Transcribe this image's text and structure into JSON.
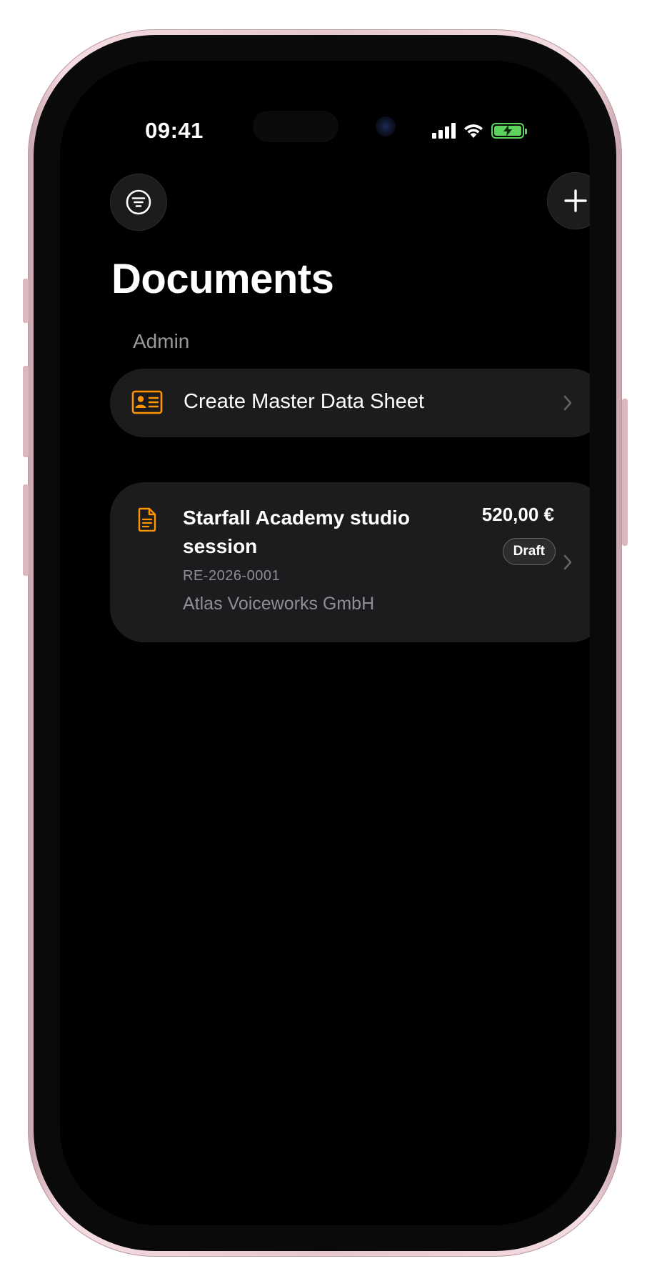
{
  "status_bar": {
    "time": "09:41",
    "icons": [
      "cellular-signal-icon",
      "wifi-icon",
      "battery-charging-icon"
    ]
  },
  "toolbar": {
    "filter_icon": "filter-menu-icon",
    "add_icon": "plus-icon"
  },
  "page": {
    "title": "Documents"
  },
  "admin_section": {
    "header": "Admin",
    "items": [
      {
        "label": "Create Master Data Sheet",
        "icon": "id-card-icon"
      }
    ]
  },
  "documents": [
    {
      "title": "Starfall Academy studio session",
      "number": "RE-2026-0001",
      "client": "Atlas Voiceworks GmbH",
      "amount": "520,00 €",
      "status": "Draft",
      "icon": "document-icon"
    }
  ],
  "colors": {
    "accent": "#ff9500",
    "background": "#000000",
    "card": "#1c1c1e",
    "secondary_text": "#8e8e93",
    "battery": "#5dd35d"
  }
}
